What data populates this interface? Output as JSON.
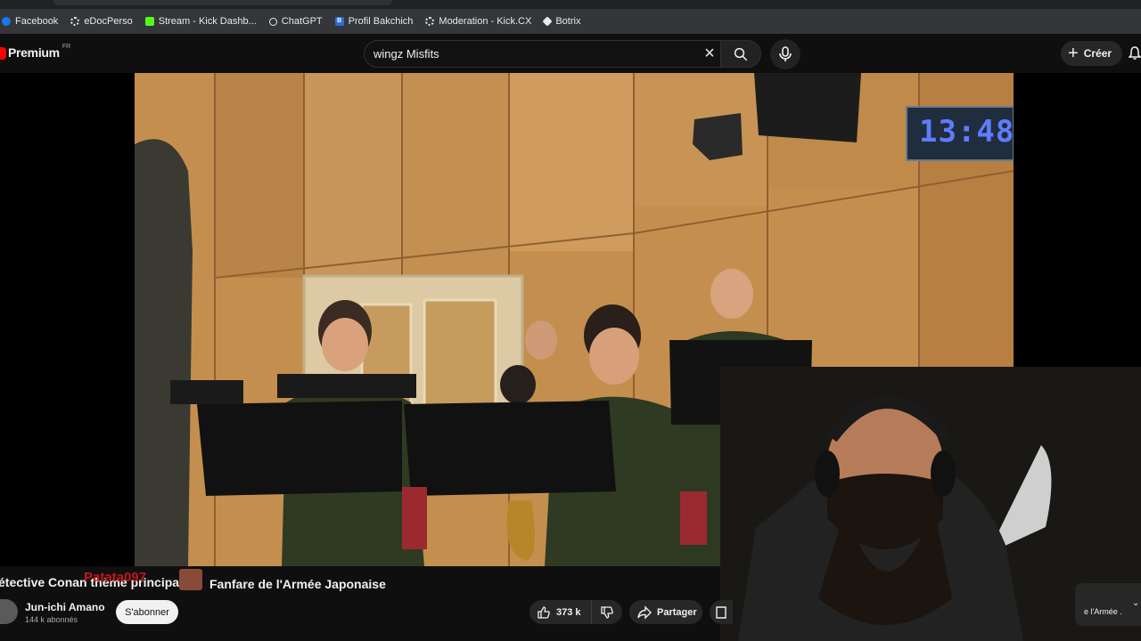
{
  "bookmarks": [
    {
      "label": "Facebook",
      "icon": "facebook-icon"
    },
    {
      "label": "eDocPerso",
      "icon": "edocperso-icon"
    },
    {
      "label": "Stream - Kick Dashb...",
      "icon": "kick-icon"
    },
    {
      "label": "ChatGPT",
      "icon": "chatgpt-icon"
    },
    {
      "label": "Profil Bakchich",
      "icon": "bakchich-icon"
    },
    {
      "label": "Moderation - Kick.CX",
      "icon": "gear-icon"
    },
    {
      "label": "Botrix",
      "icon": "botrix-icon"
    }
  ],
  "header": {
    "logo_text": "Premium",
    "logo_region": "FR",
    "search_value": "wingz Misfits",
    "create_label": "Créer"
  },
  "video": {
    "clock_display": "13:48"
  },
  "below": {
    "scrolling_title": "étective Conan thème principal",
    "chat_username": "Patata097",
    "title": "Fanfare de l'Armée Japonaise",
    "channel_name": "Jun-ichi Amano",
    "subscribers": "144 k abonnés",
    "subscribe_label": "S'abonner",
    "like_count": "373 k",
    "share_label": "Partager",
    "side_chip_text": "e l'Armée ."
  },
  "colors": {
    "background": "#0f0f0f",
    "accent_red": "#ff0000",
    "button_bg": "#272727"
  }
}
